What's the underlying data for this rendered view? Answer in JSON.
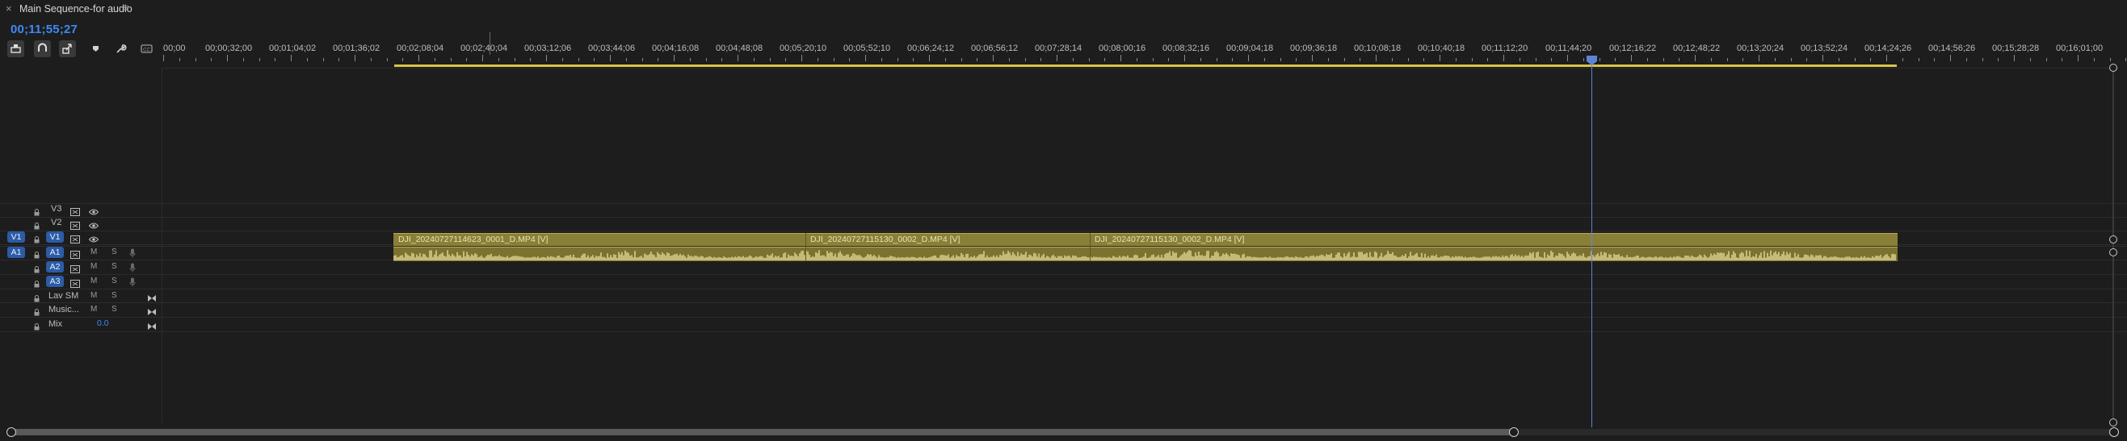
{
  "panel": {
    "close_icon": "×",
    "title": "Main Sequence-for audio",
    "menu_icon": "≡",
    "timecode": "00;11;55;27"
  },
  "toolbar": {
    "tools": [
      {
        "name": "insert-nest-icon"
      },
      {
        "name": "snap-magnet-icon"
      },
      {
        "name": "linked-selection-icon"
      },
      {
        "name": "add-marker-icon"
      },
      {
        "name": "wrench-settings-icon"
      },
      {
        "name": "captions-icon"
      }
    ]
  },
  "ruler": {
    "ticks": [
      "00;00",
      "00;00;32;00",
      "00;01;04;02",
      "00;01;36;02",
      "00;02;08;04",
      "00;02;40;04",
      "00;03;12;06",
      "00;03;44;06",
      "00;04;16;08",
      "00;04;48;08",
      "00;05;20;10",
      "00;05;52;10",
      "00;06;24;12",
      "00;06;56;12",
      "00;07;28;14",
      "00;08;00;16",
      "00;08;32;16",
      "00;09;04;18",
      "00;09;36;18",
      "00;10;08;18",
      "00;10;40;18",
      "00;11;12;20",
      "00;11;44;20",
      "00;12;16;22",
      "00;12;48;22",
      "00;13;20;24",
      "00;13;52;24",
      "00;14;24;26",
      "00;14;56;26",
      "00;15;28;28",
      "00;16;01;00"
    ]
  },
  "tracks": {
    "video": [
      {
        "src_target": "",
        "name": "V3"
      },
      {
        "src_target": "",
        "name": "V2"
      },
      {
        "src_target": "V1",
        "name": "V1"
      }
    ],
    "audio": [
      {
        "src_target": "A1",
        "name": "A1",
        "m": "M",
        "s": "S"
      },
      {
        "src_target": "",
        "name": "A2",
        "m": "M",
        "s": "S"
      },
      {
        "src_target": "",
        "name": "A3",
        "m": "M",
        "s": "S"
      }
    ],
    "submix": [
      {
        "name": "Lav SM",
        "m": "M",
        "s": "S"
      },
      {
        "name": "Music...",
        "m": "M",
        "s": "S"
      }
    ],
    "mix": {
      "name": "Mix",
      "value": "0.0"
    }
  },
  "clips": {
    "video": [
      {
        "label": "DJI_20240727114623_0001_D.MP4 [V]"
      },
      {
        "label": "DJI_20240727115130_0002_D.MP4 [V]"
      },
      {
        "label": "DJI_20240727115130_0002_D.MP4 [V]"
      }
    ]
  },
  "colors": {
    "accent": "#3d8af7",
    "clip": "#8a7f36",
    "work_area": "#d9c248",
    "target": "#2c5ba7"
  }
}
